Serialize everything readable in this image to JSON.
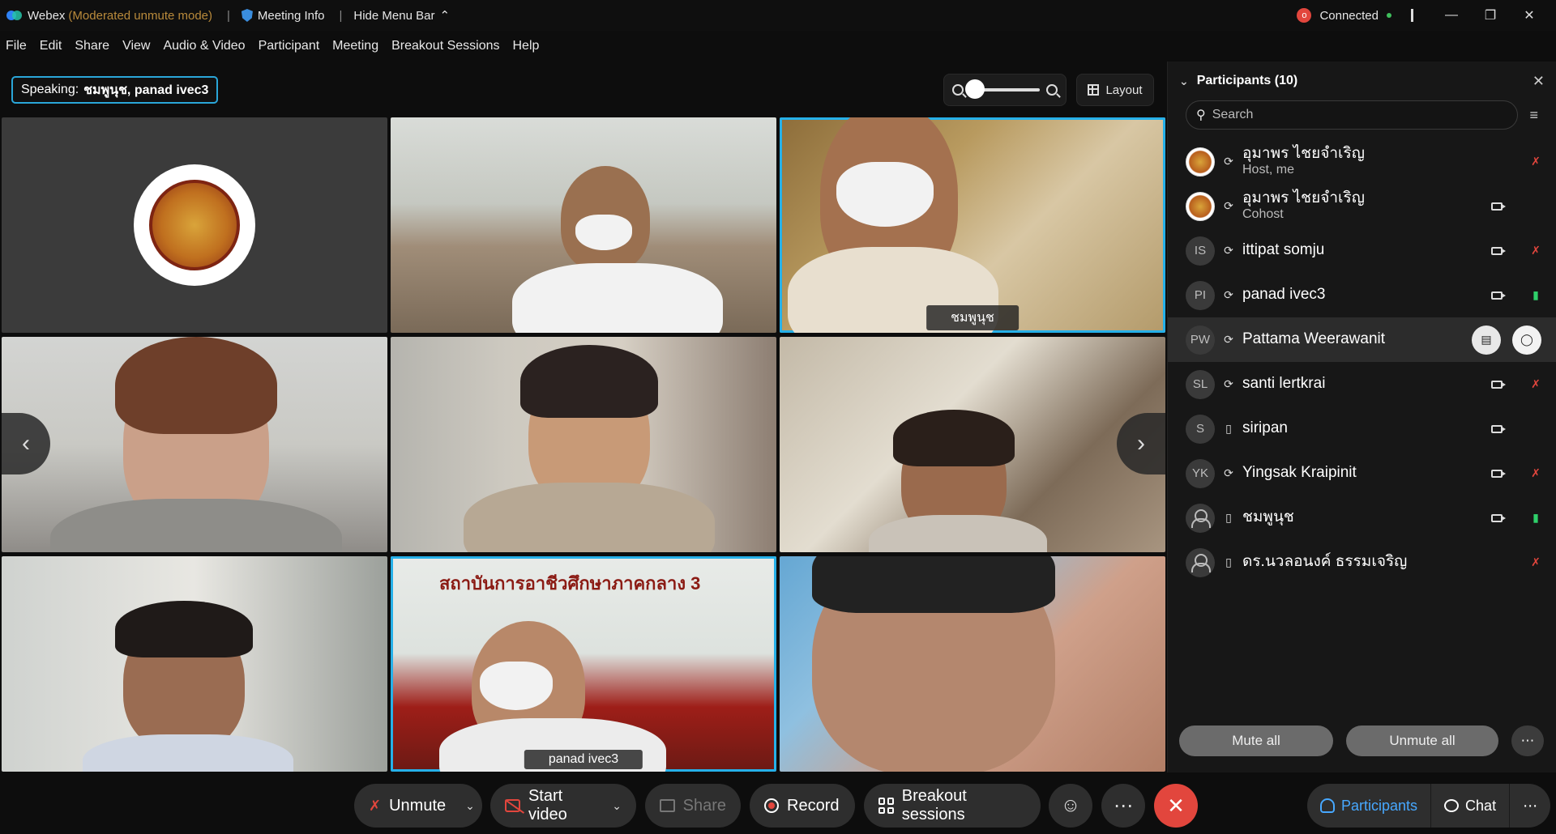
{
  "titlebar": {
    "app_name": "Webex",
    "mode": "(Moderated unmute mode)",
    "meeting_info": "Meeting Info",
    "hide_menu": "Hide Menu Bar",
    "connected": "Connected",
    "rec_indicator": "o"
  },
  "menu": [
    "File",
    "Edit",
    "Share",
    "View",
    "Audio & Video",
    "Participant",
    "Meeting",
    "Breakout Sessions",
    "Help"
  ],
  "speaking": {
    "prefix": "Speaking:",
    "names": "ชมพูนุช, panad ivec3"
  },
  "layout_label": "Layout",
  "zoom_level": 0,
  "tiles": [
    {
      "label": ""
    },
    {
      "label": ""
    },
    {
      "label": "ชมพูนุช"
    },
    {
      "label": ""
    },
    {
      "label": ""
    },
    {
      "label": ""
    },
    {
      "label": ""
    },
    {
      "label": "panad ivec3"
    },
    {
      "label": ""
    }
  ],
  "tile_banner": "สถาบันการอาชีวศึกษาภาคกลาง 3",
  "panel": {
    "title": "Participants (10)",
    "search_placeholder": "Search",
    "participants": [
      {
        "name": "อุมาพร ไชยจำเริญ",
        "role": "Host, me",
        "initials": "",
        "mic": "muted"
      },
      {
        "name": "อุมาพร ไชยจำเริญ",
        "role": "Cohost",
        "initials": "",
        "mic": ""
      },
      {
        "name": "ittipat somju",
        "role": "",
        "initials": "IS",
        "mic": "muted"
      },
      {
        "name": "panad ivec3",
        "role": "",
        "initials": "PI",
        "mic": "on"
      },
      {
        "name": "Pattama Weerawanit",
        "role": "",
        "initials": "PW",
        "mic": ""
      },
      {
        "name": "santi lertkrai",
        "role": "",
        "initials": "SL",
        "mic": "muted"
      },
      {
        "name": "siripan",
        "role": "",
        "initials": "S",
        "mic": ""
      },
      {
        "name": "Yingsak Kraipinit",
        "role": "",
        "initials": "YK",
        "mic": "muted"
      },
      {
        "name": "ชมพูนุช",
        "role": "",
        "initials": "",
        "mic": "on"
      },
      {
        "name": "ดร.นวลอนงค์ ธรรมเจริญ",
        "role": "",
        "initials": "",
        "mic": "muted"
      }
    ],
    "mute_all": "Mute all",
    "unmute_all": "Unmute all"
  },
  "controls": {
    "unmute": "Unmute",
    "start_video": "Start video",
    "share": "Share",
    "record": "Record",
    "breakout": "Breakout sessions",
    "participants": "Participants",
    "chat": "Chat"
  },
  "colors": {
    "accent": "#26b0e8",
    "end_call": "#e2463d",
    "active_tab": "#47a8ff"
  }
}
